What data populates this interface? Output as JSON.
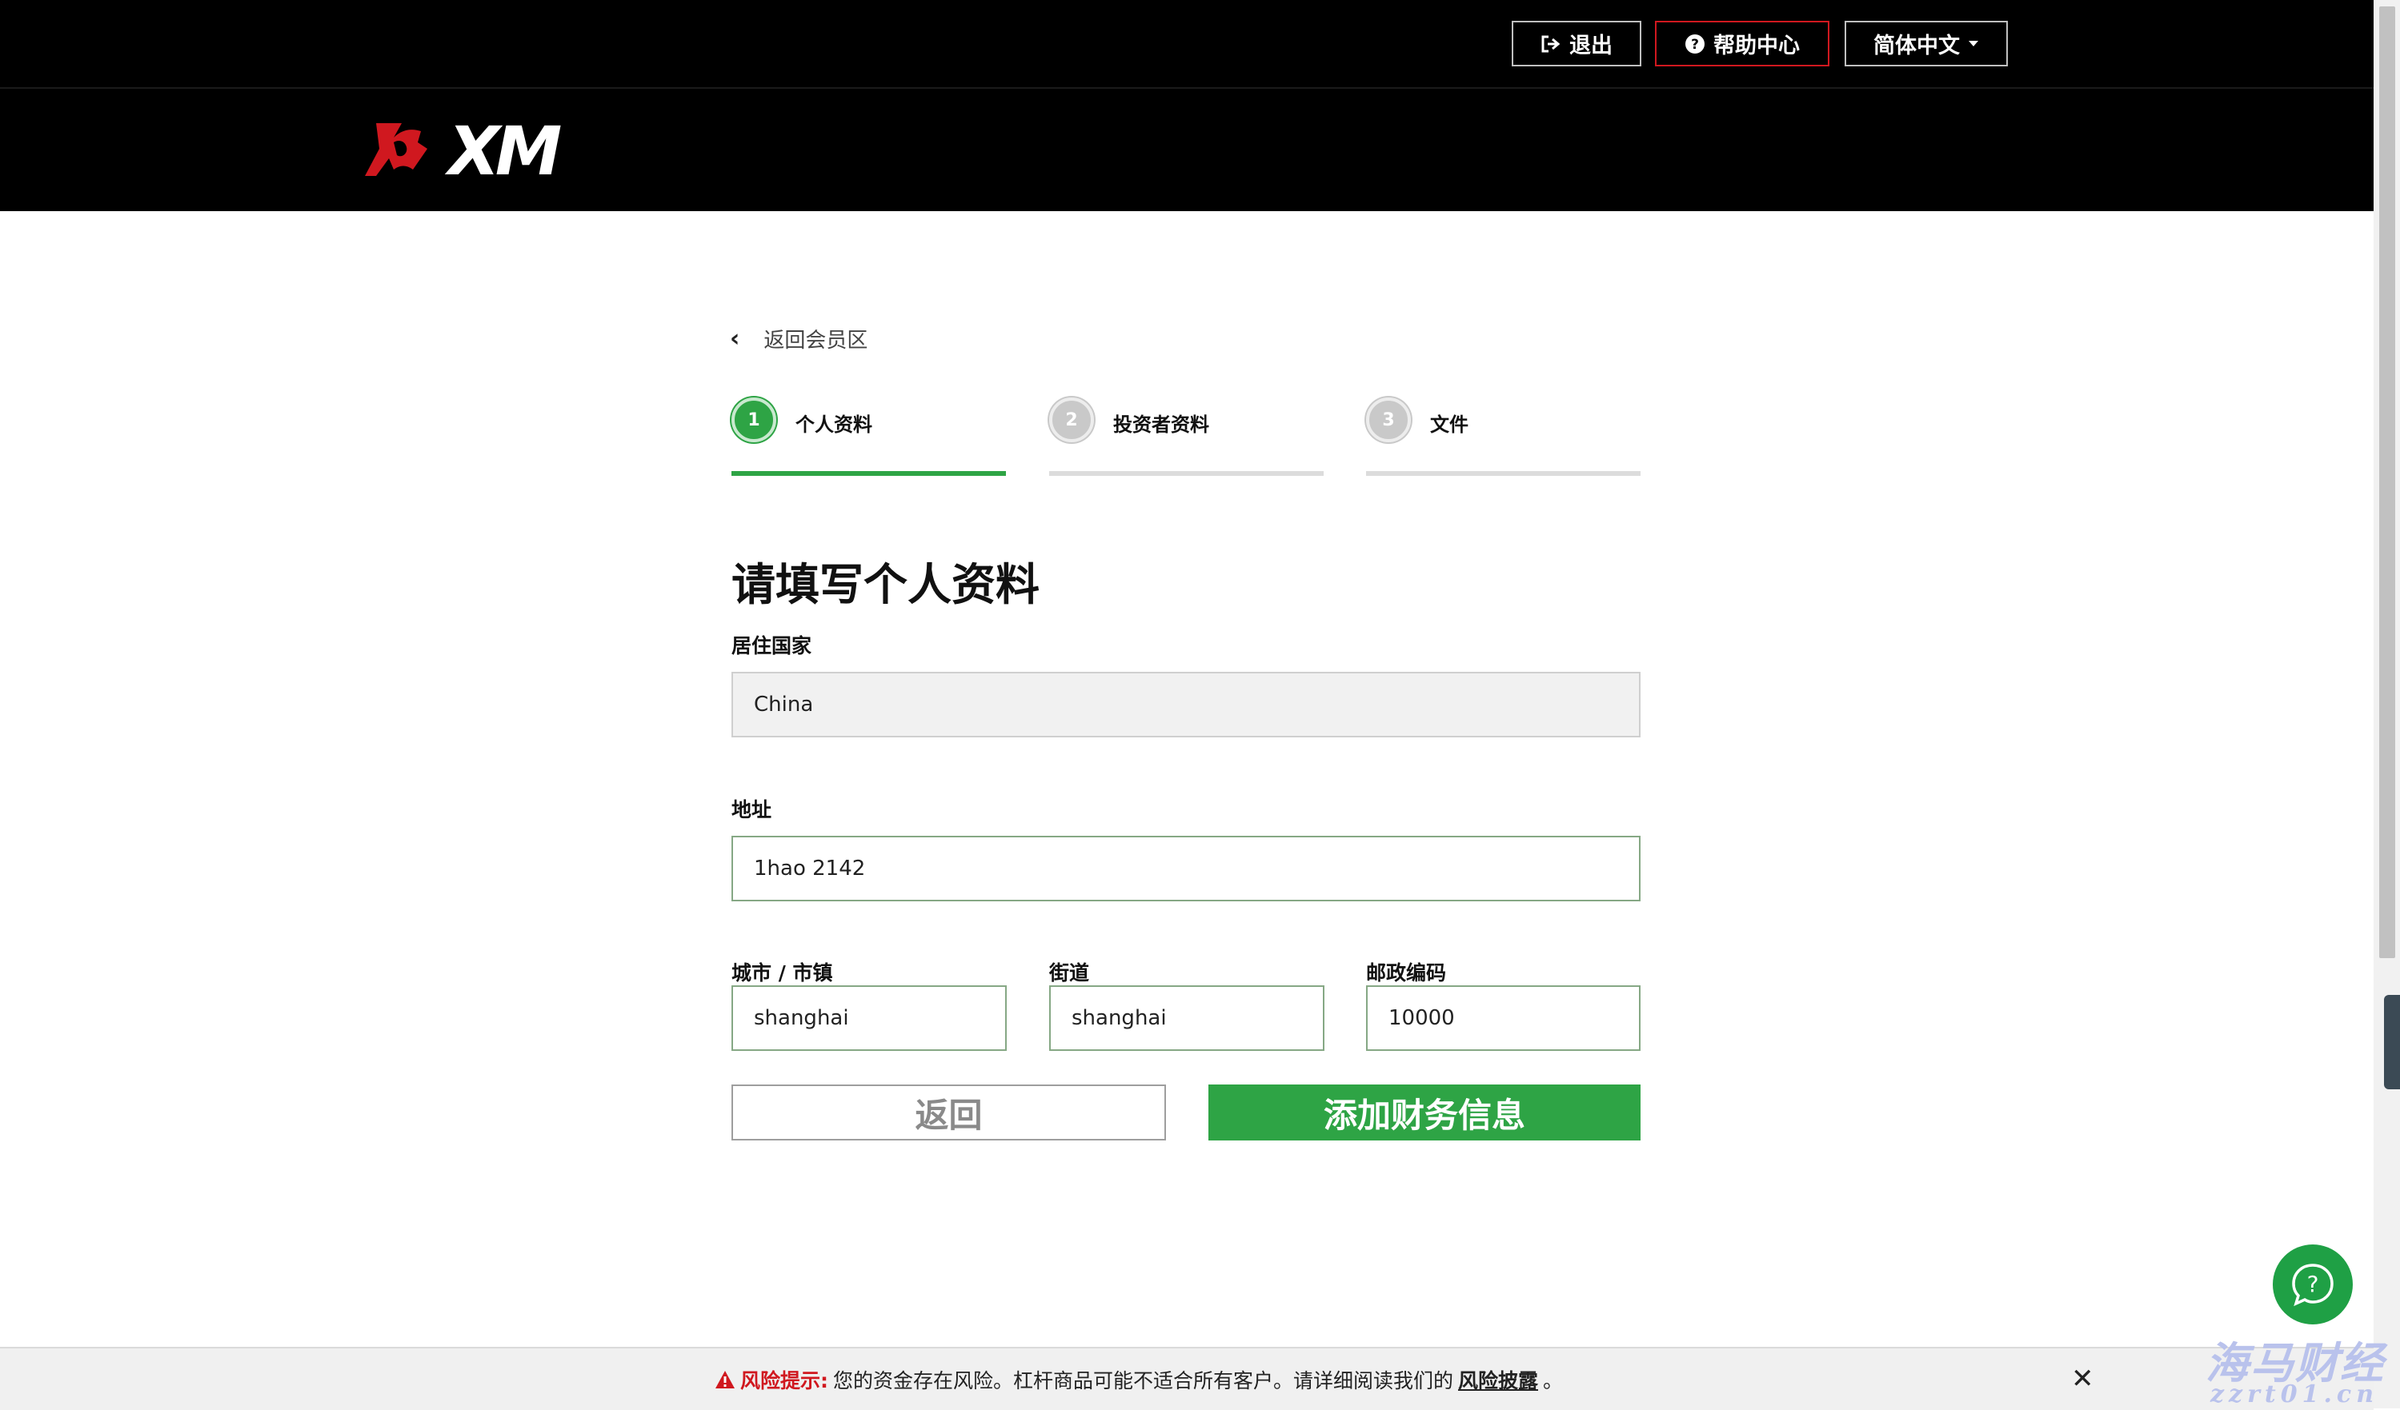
{
  "header": {
    "logout_label": "退出",
    "help_label": "帮助中心",
    "language_label": "简体中文",
    "logo_text": "XM"
  },
  "nav": {
    "back_label": "返回会员区"
  },
  "steps": [
    {
      "number": "1",
      "label": "个人资料",
      "state": "active"
    },
    {
      "number": "2",
      "label": "投资者资料",
      "state": "inactive"
    },
    {
      "number": "3",
      "label": "文件",
      "state": "inactive"
    }
  ],
  "form": {
    "title": "请填写个人资料",
    "country": {
      "label": "居住国家",
      "value": "China"
    },
    "address": {
      "label": "地址",
      "value": "1hao 2142"
    },
    "city": {
      "label": "城市 / 市镇",
      "value": "shanghai"
    },
    "street": {
      "label": "街道",
      "value": "shanghai"
    },
    "postal": {
      "label": "邮政编码",
      "value": "10000"
    },
    "back_button": "返回",
    "next_button": "添加财务信息"
  },
  "risk": {
    "title": "风险提示:",
    "text": "您的资金存在风险。杠杆商品可能不适合所有客户。请详细阅读我们的",
    "link": "风险披露",
    "end": "。"
  },
  "watermark": {
    "line1": "海马财经",
    "line2": "zzrt01.cn"
  },
  "colors": {
    "brand_red": "#d0181f",
    "accent_green": "#2ea445",
    "header_bg": "#000000"
  }
}
